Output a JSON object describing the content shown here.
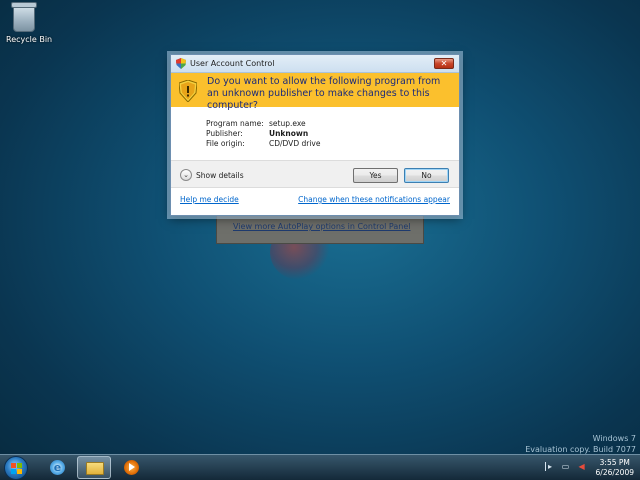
{
  "desktop": {
    "recycle_bin_label": "Recycle Bin",
    "watermark_line1": "Windows 7",
    "watermark_line2": "Evaluation copy. Build 7077"
  },
  "autoplay": {
    "link_text": "View more AutoPlay options in Control Panel"
  },
  "uac": {
    "title": "User Account Control",
    "close_glyph": "✕",
    "question": "Do you want to allow the following program from an unknown publisher to make changes to this computer?",
    "fields": [
      {
        "label": "Program name:",
        "value": "setup.exe"
      },
      {
        "label": "Publisher:",
        "value": "Unknown"
      },
      {
        "label": "File origin:",
        "value": "CD/DVD drive"
      }
    ],
    "show_details_label": "Show details",
    "show_details_glyph": "⌄",
    "yes_label": "Yes",
    "no_label": "No",
    "help_link": "Help me decide",
    "change_link": "Change when these notifications appear",
    "banner_color": "#fbc02d"
  },
  "taskbar": {
    "icons": [
      "start-orb",
      "internet-explorer-icon",
      "windows-explorer-icon",
      "media-player-icon"
    ],
    "ie_glyph": "e",
    "tray_glyphs": [
      "▸",
      "▭",
      "◀"
    ],
    "clock_time": "3:55 PM",
    "clock_date": "6/26/2009"
  }
}
